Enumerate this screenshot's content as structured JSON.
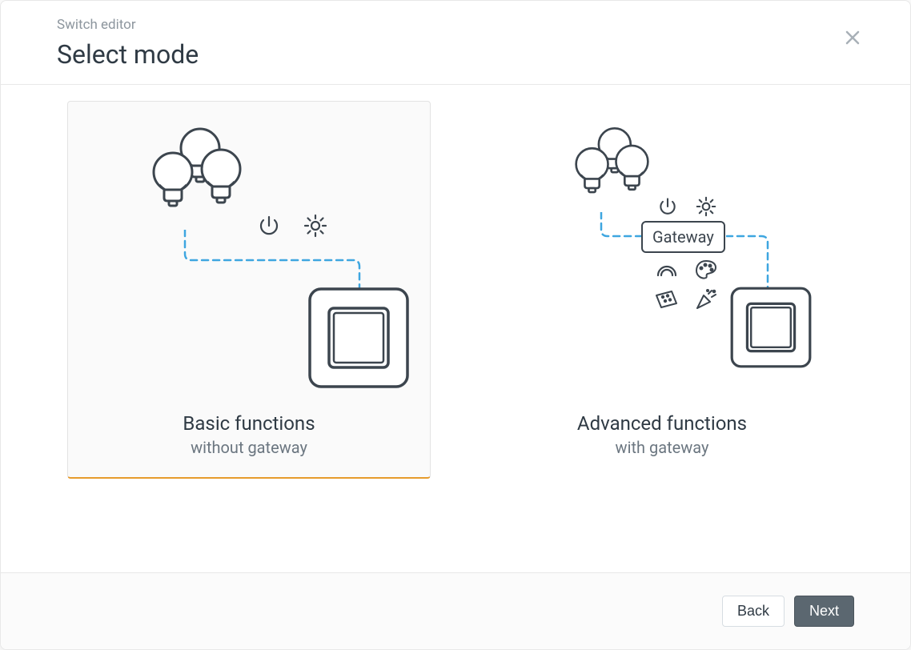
{
  "header": {
    "subtitle": "Switch editor",
    "title": "Select mode"
  },
  "options": {
    "basic": {
      "title": "Basic functions",
      "subtitle": "without gateway",
      "selected": true
    },
    "advanced": {
      "title": "Advanced functions",
      "subtitle": "with gateway",
      "gateway_label": "Gateway",
      "selected": false
    }
  },
  "footer": {
    "back_label": "Back",
    "next_label": "Next"
  },
  "icons": {
    "power": "power-icon",
    "sun": "sun-icon",
    "rainbow": "rainbow-icon",
    "palette": "palette-icon",
    "ticket": "ticket-icon",
    "party": "party-icon"
  },
  "colors": {
    "stroke": "#3c454e",
    "dash": "#3ea6e0",
    "selected_accent": "#e69b2c"
  }
}
